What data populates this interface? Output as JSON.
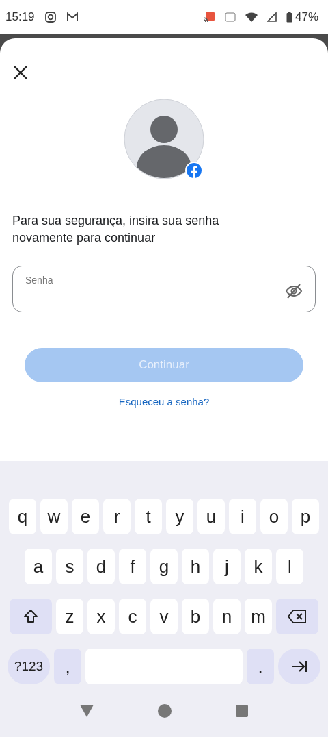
{
  "status_bar": {
    "time": "15:19",
    "battery": "47%"
  },
  "prompt": "Para sua segurança, insira sua senha novamente para continuar",
  "password_field": {
    "placeholder": "Senha"
  },
  "continue_button": {
    "label": "Continuar",
    "disabled": true
  },
  "forgot_link": "Esqueceu a senha?",
  "keyboard": {
    "rows": [
      {
        "keys": [
          {
            "kind": "letter",
            "label": "q"
          },
          {
            "kind": "letter",
            "label": "w"
          },
          {
            "kind": "letter",
            "label": "e"
          },
          {
            "kind": "letter",
            "label": "r"
          },
          {
            "kind": "letter",
            "label": "t"
          },
          {
            "kind": "letter",
            "label": "y"
          },
          {
            "kind": "letter",
            "label": "u"
          },
          {
            "kind": "letter",
            "label": "i"
          },
          {
            "kind": "letter",
            "label": "o"
          },
          {
            "kind": "letter",
            "label": "p"
          }
        ]
      },
      {
        "keys": [
          {
            "kind": "letter",
            "label": "a"
          },
          {
            "kind": "letter",
            "label": "s"
          },
          {
            "kind": "letter",
            "label": "d"
          },
          {
            "kind": "letter",
            "label": "f"
          },
          {
            "kind": "letter",
            "label": "g"
          },
          {
            "kind": "letter",
            "label": "h"
          },
          {
            "kind": "letter",
            "label": "j"
          },
          {
            "kind": "letter",
            "label": "k"
          },
          {
            "kind": "letter",
            "label": "l"
          }
        ]
      },
      {
        "keys": [
          {
            "kind": "shift"
          },
          {
            "kind": "letter",
            "label": "z"
          },
          {
            "kind": "letter",
            "label": "x"
          },
          {
            "kind": "letter",
            "label": "c"
          },
          {
            "kind": "letter",
            "label": "v"
          },
          {
            "kind": "letter",
            "label": "b"
          },
          {
            "kind": "letter",
            "label": "n"
          },
          {
            "kind": "letter",
            "label": "m"
          },
          {
            "kind": "backspace"
          }
        ]
      },
      {
        "keys": [
          {
            "kind": "symbols",
            "label": "?123"
          },
          {
            "kind": "comma",
            "label": ","
          },
          {
            "kind": "space"
          },
          {
            "kind": "period",
            "label": "."
          },
          {
            "kind": "enter"
          }
        ]
      }
    ]
  }
}
